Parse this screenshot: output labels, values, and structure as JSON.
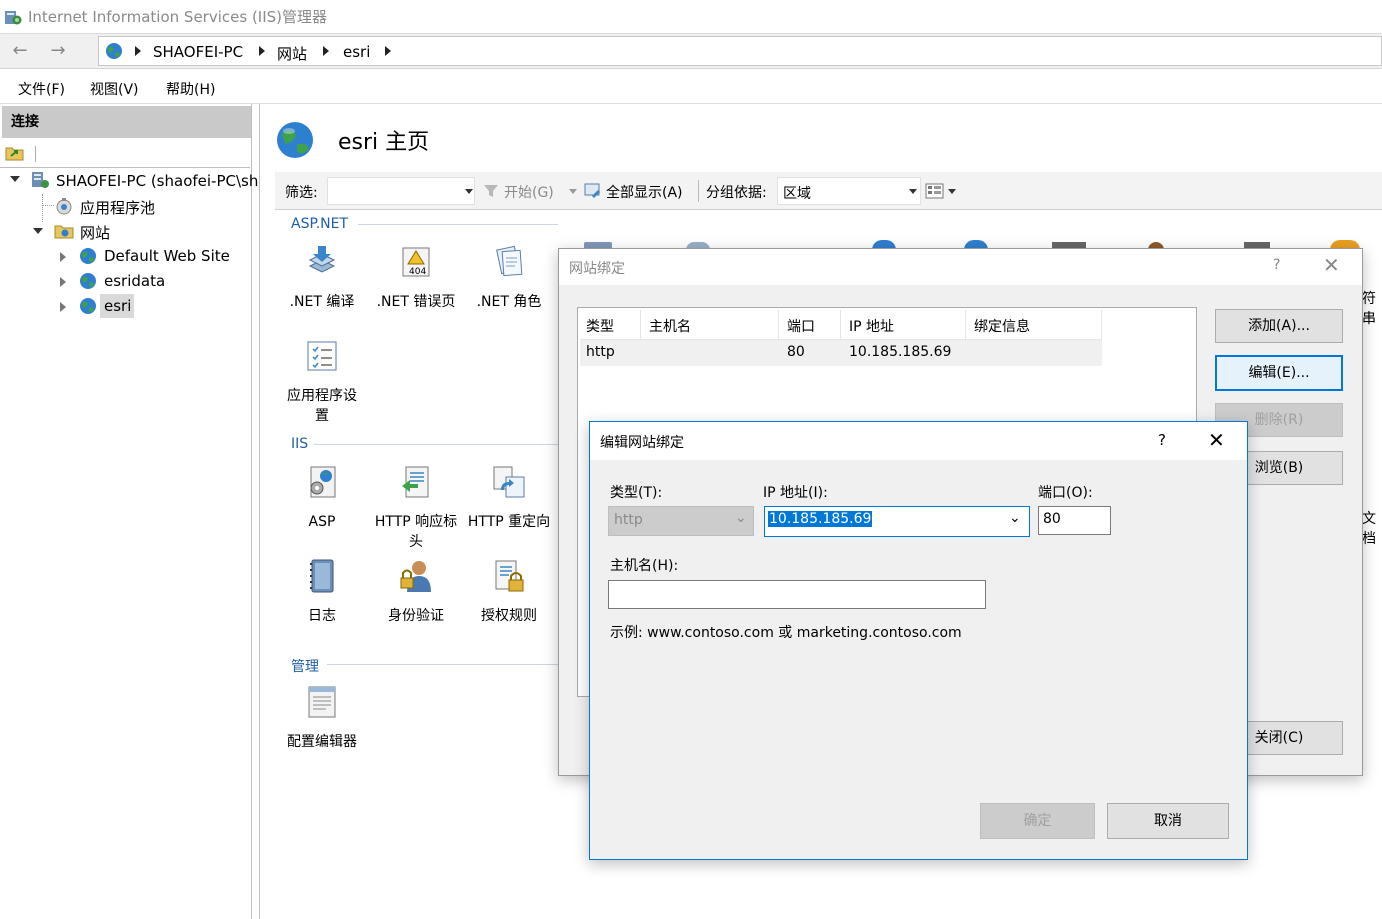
{
  "window": {
    "title": "Internet Information Services (IIS)管理器"
  },
  "breadcrumb": [
    "SHAOFEI-PC",
    "网站",
    "esri"
  ],
  "menu": [
    "文件(F)",
    "视图(V)",
    "帮助(H)"
  ],
  "connections": {
    "header": "连接",
    "tree": {
      "server": "SHAOFEI-PC (shaofei-PC\\sh",
      "app_pools": "应用程序池",
      "sites": "网站",
      "site_items": [
        "Default Web Site",
        "esridata",
        "esri"
      ]
    }
  },
  "page": {
    "title": "esri 主页"
  },
  "filter": {
    "label": "筛选:",
    "start": "开始(G)",
    "show_all": "全部显示(A)",
    "group_label": "分组依据:",
    "group_value": "区域"
  },
  "sections": {
    "aspnet": "ASP.NET",
    "iis": "IIS",
    "management": "管理"
  },
  "features": {
    "net_compile": ".NET 编译",
    "net_errors": ".NET 错误页",
    "net_roles": ".NET 角色",
    "app_settings_1": "应用程序设",
    "app_settings_2": "置",
    "asp": "ASP",
    "http_headers_1": "HTTP 响应标",
    "http_headers_2": "头",
    "http_redirect": "HTTP 重定向",
    "logging": "日志",
    "auth": "身份验证",
    "authz": "授权规则",
    "config_editor": "配置编辑器",
    "partial_right_1": "符串",
    "partial_right_2": "文档"
  },
  "bindings_dialog": {
    "title": "网站绑定",
    "help": "?",
    "columns": [
      "类型",
      "主机名",
      "端口",
      "IP 地址",
      "绑定信息"
    ],
    "rows": [
      {
        "type": "http",
        "host": "",
        "port": "80",
        "ip": "10.185.185.69",
        "info": ""
      }
    ],
    "buttons": {
      "add": "添加(A)...",
      "edit": "编辑(E)...",
      "remove": "删除(R)",
      "browse": "浏览(B)",
      "close": "关闭(C)"
    }
  },
  "edit_dialog": {
    "title": "编辑网站绑定",
    "help": "?",
    "type_label": "类型(T):",
    "type_value": "http",
    "ip_label": "IP 地址(I):",
    "ip_value": "10.185.185.69",
    "port_label": "端口(O):",
    "port_value": "80",
    "host_label": "主机名(H):",
    "host_value": "",
    "example": "示例: www.contoso.com 或 marketing.contoso.com",
    "ok": "确定",
    "cancel": "取消"
  }
}
